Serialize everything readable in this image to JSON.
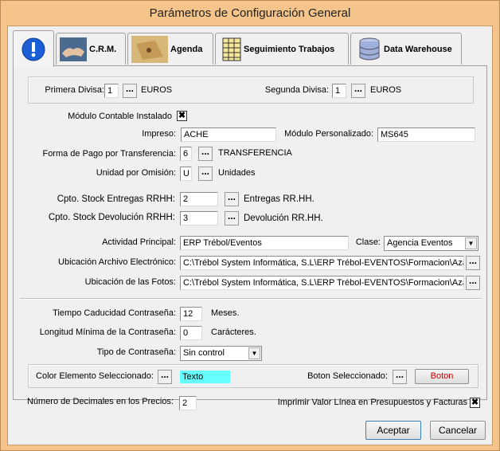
{
  "window": {
    "title": "Parámetros de Configuración General"
  },
  "tabs": [
    {
      "label": "",
      "icon": "info-icon"
    },
    {
      "label": "C.R.M.",
      "icon": "handshake-icon"
    },
    {
      "label": "Agenda",
      "icon": "calendar-icon"
    },
    {
      "label": "Seguimiento Trabajos",
      "icon": "spreadsheet-icon"
    },
    {
      "label": "Data Warehouse",
      "icon": "database-icon"
    }
  ],
  "currency": {
    "first_label": "Primera Divisa:",
    "first_value": "1",
    "first_name": "EUROS",
    "second_label": "Segunda Divisa:",
    "second_value": "1",
    "second_name": "EUROS"
  },
  "accounting": {
    "label": "Módulo Contable Instalado",
    "checked": "✖"
  },
  "impreso": {
    "label": "Impreso:",
    "value": "ACHE"
  },
  "modulo_personalizado": {
    "label": "Módulo Personalizado:",
    "value": "MS645"
  },
  "forma_pago": {
    "label": "Forma de Pago por Transferencia:",
    "value": "6",
    "name": "TRANSFERENCIA"
  },
  "unidad": {
    "label": "Unidad por Omisión:",
    "value": "U",
    "name": "Unidades"
  },
  "stock_entregas": {
    "label": "Cpto. Stock Entregas RRHH:",
    "value": "2",
    "name": "Entregas RR.HH."
  },
  "stock_devolucion": {
    "label": "Cpto. Stock Devolución RRHH:",
    "value": "3",
    "name": "Devolución RR.HH."
  },
  "actividad": {
    "label": "Actividad Principal:",
    "value": "ERP Trébol/Eventos"
  },
  "clase": {
    "label": "Clase:",
    "value": "Agencia Eventos"
  },
  "archivo_electronico": {
    "label": "Ubicación Archivo Electrónico:",
    "value": "C:\\Trébol System Informática, S.L\\ERP Trébol-EVENTOS\\Formacion\\Aza"
  },
  "fotos": {
    "label": "Ubicación de las Fotos:",
    "value": "C:\\Trébol System Informática, S.L\\ERP Trébol-EVENTOS\\Formacion\\Aza"
  },
  "password": {
    "caducidad_label": "Tiempo Caducidad Contraseña:",
    "caducidad_value": "12",
    "caducidad_unit": "Meses.",
    "longitud_label": "Longitud Mínima de la Contraseña:",
    "longitud_value": "0",
    "longitud_unit": "Carácteres.",
    "tipo_label": "Tipo de Contraseña:",
    "tipo_value": "Sin control"
  },
  "colors": {
    "elemento_label": "Color Elemento Seleccionado:",
    "elemento_sample": "Texto",
    "elemento_color": "#66ffff",
    "boton_label": "Boton Seleccionado:",
    "boton_sample": "Boton",
    "boton_text_color": "#cc0000"
  },
  "decimales": {
    "label": "Número de Decimales en los Precios:",
    "value": "2"
  },
  "imprimir": {
    "label": "Imprimir Valor Línea en Presupuestos y Facturas",
    "checked": "✖"
  },
  "buttons": {
    "accept": "Aceptar",
    "cancel": "Cancelar"
  },
  "dots": "..."
}
